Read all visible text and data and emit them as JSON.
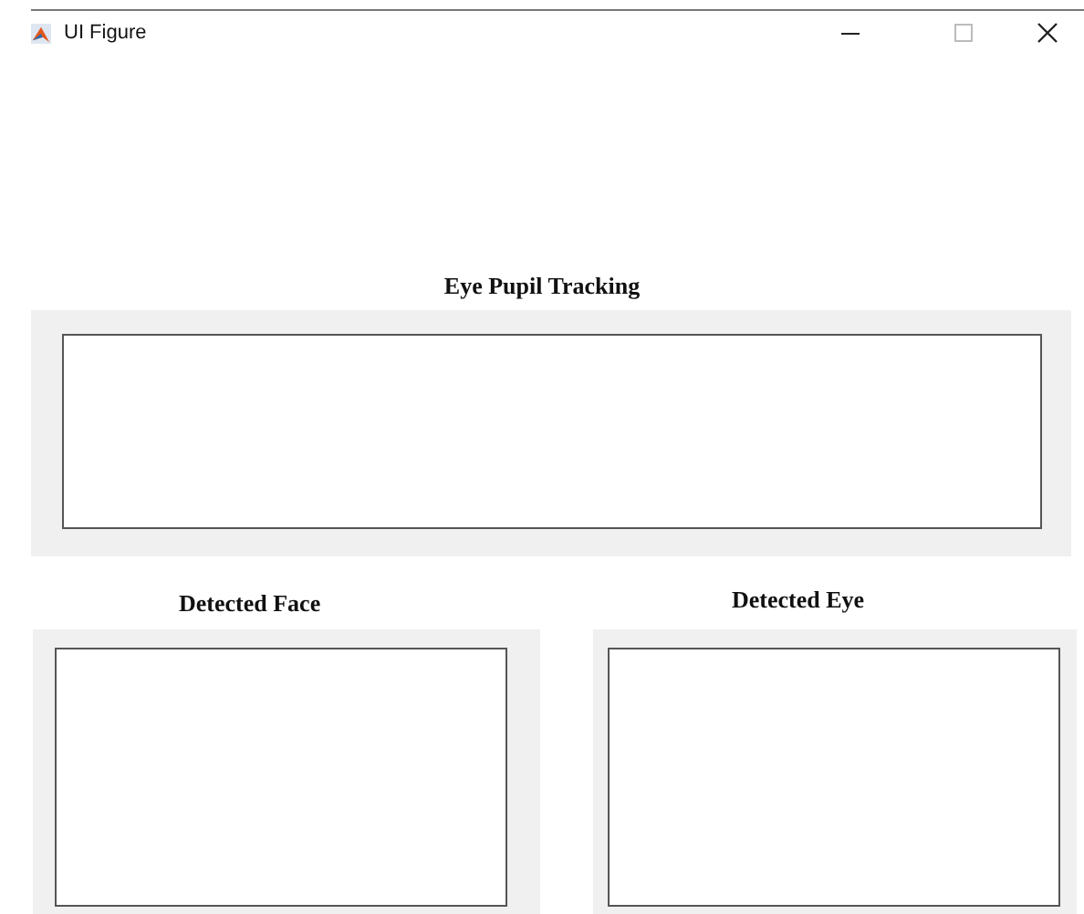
{
  "window": {
    "title": "UI Figure"
  },
  "main_panel": {
    "title": "Eye Pupil Tracking"
  },
  "panels": [
    {
      "title": "Detected Face"
    },
    {
      "title": "Detected Eye"
    }
  ]
}
